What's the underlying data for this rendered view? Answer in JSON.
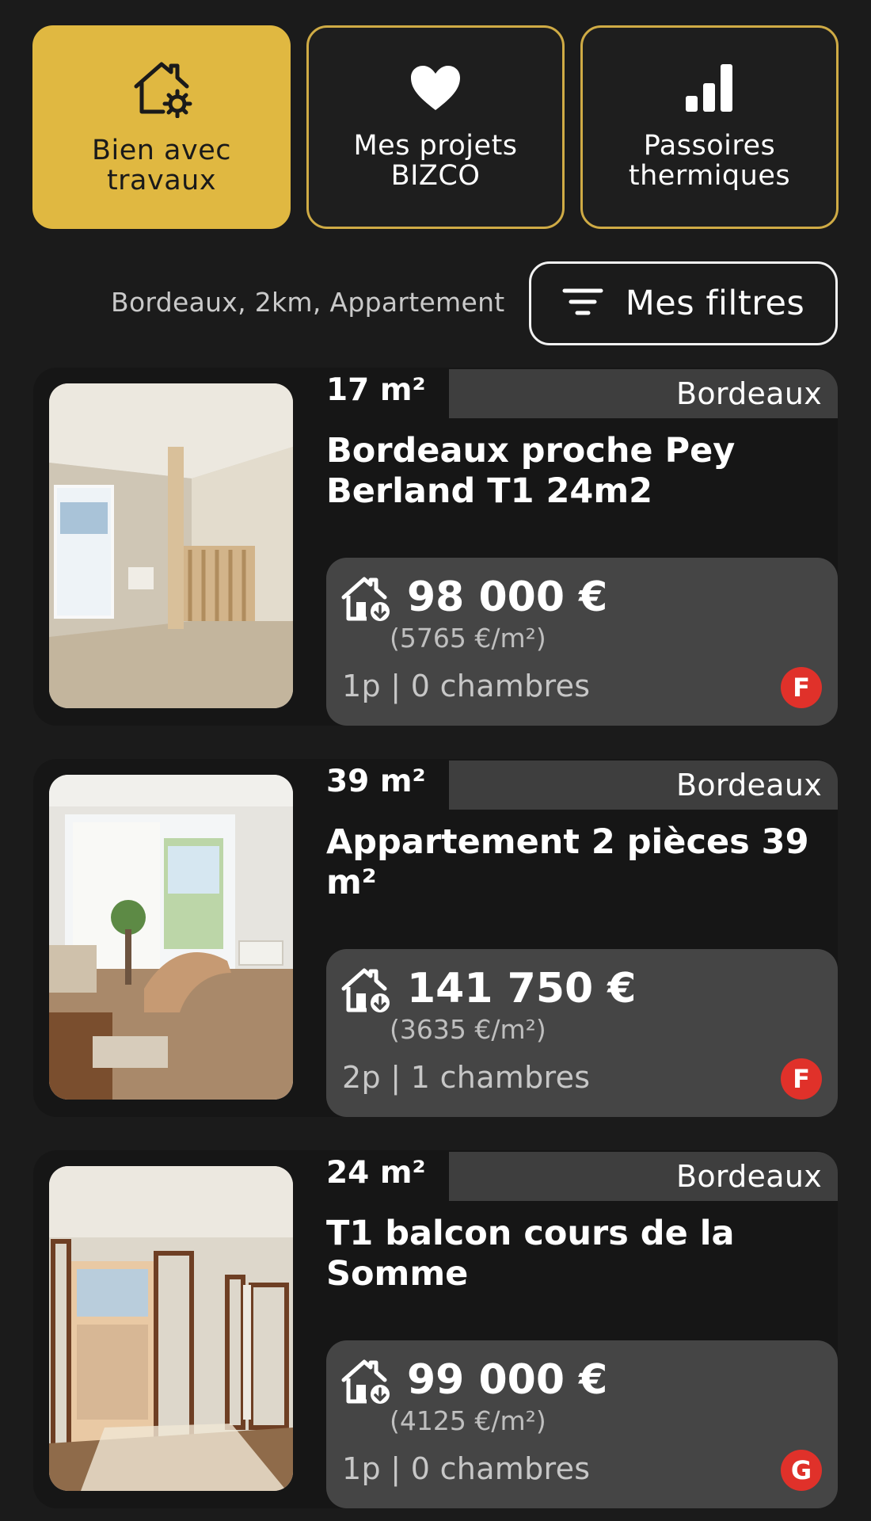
{
  "categories": [
    {
      "label": "Bien avec travaux",
      "icon": "house-gear-icon",
      "active": true
    },
    {
      "label": "Mes projets BIZCO",
      "icon": "heart-icon",
      "active": false
    },
    {
      "label": "Passoires thermiques",
      "icon": "signal-bars-icon",
      "active": false
    }
  ],
  "filters": {
    "summary": "Bordeaux, 2km, Appartement",
    "button_label": "Mes filtres",
    "icon": "filter-lines-icon"
  },
  "listings": [
    {
      "area": "17 m²",
      "city": "Bordeaux",
      "title": "Bordeaux proche Pey Berland T1 24m2",
      "price": "98 000 €",
      "price_per_m2": "(5765 €/m²)",
      "rooms": "1p | 0 chambres",
      "dpe": "F"
    },
    {
      "area": "39 m²",
      "city": "Bordeaux",
      "title": "Appartement 2 pièces 39 m²",
      "price": "141 750 €",
      "price_per_m2": "(3635 €/m²)",
      "rooms": "2p | 1 chambres",
      "dpe": "F"
    },
    {
      "area": "24 m²",
      "city": "Bordeaux",
      "title": "T1 balcon cours de la Somme",
      "price": "99 000 €",
      "price_per_m2": "(4125 €/m²)",
      "rooms": "1p | 0 chambres",
      "dpe": "G"
    }
  ],
  "colors": {
    "background": "#1b1b1b",
    "accent": "#e0b841",
    "card": "#161616",
    "price_box": "#454545",
    "city_band": "#3e3e3e",
    "dpe_badge": "#e0312a"
  }
}
